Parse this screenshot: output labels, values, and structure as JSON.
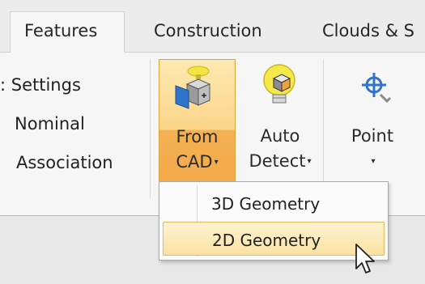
{
  "tabs": [
    {
      "label": "Features",
      "active": true
    },
    {
      "label": "Construction",
      "active": false
    },
    {
      "label": "Clouds & S",
      "active": false
    }
  ],
  "left_group": {
    "items": [
      ": Settings",
      "Nominal",
      "Association"
    ]
  },
  "buttons": {
    "from_cad": {
      "line1": "From",
      "line2": "CAD",
      "arrow": "▾",
      "highlighted": true,
      "icon": "from-cad-icon"
    },
    "auto_detect": {
      "line1": "Auto",
      "line2": "Detect",
      "arrow": "▾",
      "icon": "lightbulb-icon"
    },
    "point": {
      "line1": "Point",
      "arrow": "▾",
      "icon": "point-target-icon"
    }
  },
  "dropdown_menu": {
    "items": [
      {
        "label": "3D Geometry",
        "highlighted": false
      },
      {
        "label": "2D Geometry",
        "highlighted": true
      }
    ]
  },
  "colors": {
    "accent_orange": "#f5a94a",
    "highlight_yellow": "#fbe2a2",
    "icon_blue": "#2f74c8"
  }
}
